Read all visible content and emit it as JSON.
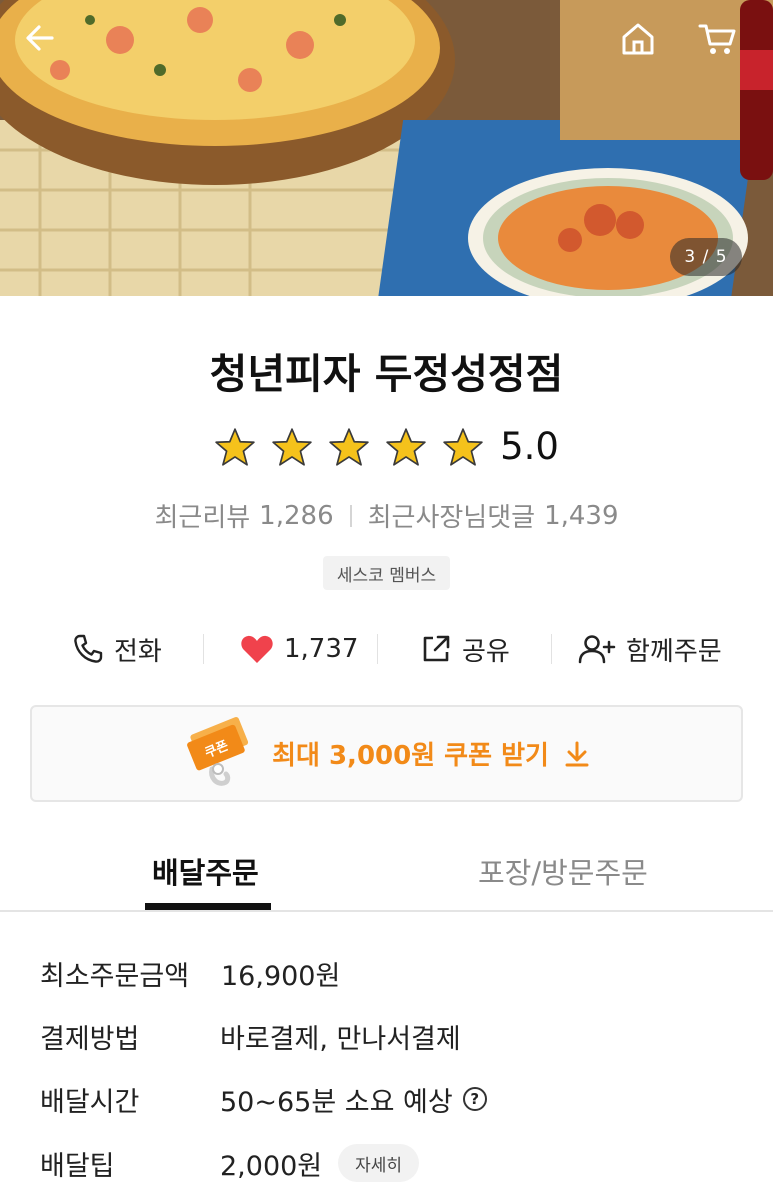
{
  "hero": {
    "image_counter": "3 / 5",
    "icons": {
      "back": "arrow-left-icon",
      "home": "home-icon",
      "cart": "cart-icon"
    }
  },
  "store": {
    "name": "청년피자 두정성정점",
    "rating": "5.0",
    "star_count": 5,
    "star_color": "#f5c21b",
    "recent_reviews_label": "최근리뷰",
    "recent_reviews_count": "1,286",
    "owner_replies_label": "최근사장님댓글",
    "owner_replies_count": "1,439",
    "badge": "세스코 멤버스"
  },
  "actions": {
    "call_label": "전화",
    "like_count": "1,737",
    "share_label": "공유",
    "group_order_label": "함께주문",
    "heart_color": "#f0424c"
  },
  "coupon": {
    "label": "최대 3,000원 쿠폰 받기",
    "ticket_text": "쿠폰",
    "accent_color": "#f28a18"
  },
  "tabs": {
    "delivery": "배달주문",
    "pickup": "포장/방문주문",
    "active": "delivery"
  },
  "info": {
    "min_order_label": "최소주문금액",
    "min_order_value": "16,900원",
    "payment_label": "결제방법",
    "payment_value": "바로결제, 만나서결제",
    "delivery_time_label": "배달시간",
    "delivery_time_value": "50~65분 소요 예상",
    "delivery_tip_label": "배달팁",
    "delivery_tip_value": "2,000원",
    "detail_button": "자세히"
  }
}
